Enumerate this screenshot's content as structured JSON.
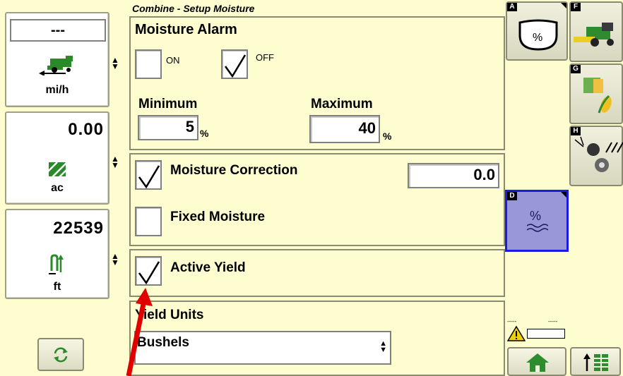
{
  "header": {
    "title": "Combine - Setup Moisture"
  },
  "left_panels": [
    {
      "value": "---",
      "unit": "mi/h",
      "icon": "combine-speed-icon"
    },
    {
      "value": "0.00",
      "unit": "ac",
      "icon": "area-icon"
    },
    {
      "value": "22539",
      "unit": "ft",
      "icon": "header-height-icon"
    }
  ],
  "moisture_alarm": {
    "title": "Moisture Alarm",
    "on_label": "ON",
    "on_checked": false,
    "off_label": "OFF",
    "off_checked": true,
    "minimum_label": "Minimum",
    "minimum_value": "5",
    "maximum_label": "Maximum",
    "maximum_value": "40",
    "percent": "%"
  },
  "correction": {
    "moisture_correction_label": "Moisture Correction",
    "moisture_correction_checked": true,
    "moisture_correction_value": "0.0",
    "fixed_moisture_label": "Fixed Moisture",
    "fixed_moisture_checked": false
  },
  "active_yield": {
    "label": "Active Yield",
    "checked": true
  },
  "yield_units": {
    "label": "Yield Units",
    "selected": "Bushels"
  },
  "right_buttons": [
    {
      "letter": "A",
      "icon": "moisture-tank-icon"
    },
    {
      "letter": "F",
      "icon": "combine-icon"
    },
    {
      "letter": "G",
      "icon": "field-crop-icon"
    },
    {
      "letter": "H",
      "icon": "fan-rotor-icon"
    },
    {
      "letter": "D",
      "icon": "moisture-percent-icon",
      "percent": "%"
    }
  ],
  "status": {
    "dash1": "-----",
    "dash2": "-----"
  },
  "colors": {
    "background": "#fdfdd0",
    "selected": "#9898d8",
    "selected_border": "#1a1ae0",
    "arrow": "#e00000"
  }
}
